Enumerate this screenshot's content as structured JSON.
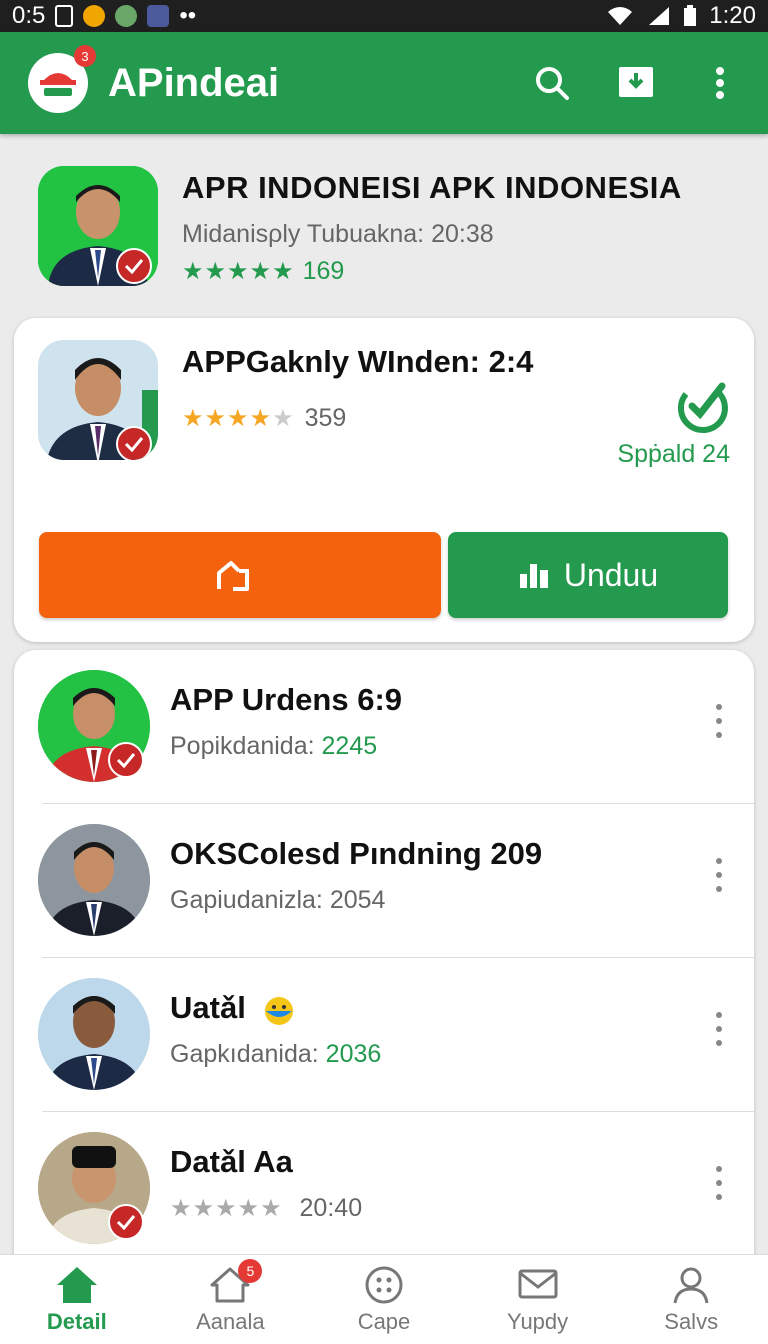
{
  "status_bar": {
    "left_text": "0:5",
    "time": "1:20"
  },
  "app_bar": {
    "title": "APindeai",
    "logo_badge": "3"
  },
  "header_app": {
    "title": "APR INDONEISI APK INDONESIA",
    "subtitle": "Midanisρly Tubuakna: 20:38",
    "stars": "★★★★★",
    "rating_count": "169"
  },
  "featured": {
    "title": "APPGaknly WInden: 2:4",
    "stars_filled": "★★★★",
    "stars_empty": "★",
    "rating_count": "359",
    "status_label": "Spṗald 24",
    "share_button_label": "",
    "download_button_label": "Unduu"
  },
  "list": [
    {
      "title": "APP Urdens 6:9",
      "sub_label": "Popikdanida: ",
      "sub_value": "2245",
      "value_green": true
    },
    {
      "title": "OKSColesd Pındning 209",
      "sub_label": "Gapiudanizla: ",
      "sub_value": "2054",
      "value_green": false
    },
    {
      "title": "Uatǎl",
      "sub_label": "Gapkıdanida: ",
      "sub_value": "2036",
      "value_green": true
    },
    {
      "title": "Datǎl Aa",
      "sub_label": "",
      "sub_value": "20:40",
      "value_green": false,
      "stars": "★★★★★"
    }
  ],
  "bottom_nav": [
    {
      "label": "Detail",
      "icon": "home-icon",
      "active": true
    },
    {
      "label": "Aanala",
      "icon": "house-outline-icon",
      "badge": "5"
    },
    {
      "label": "Cape",
      "icon": "grid-icon"
    },
    {
      "label": "Yupdy",
      "icon": "mail-icon"
    },
    {
      "label": "Salvs",
      "icon": "person-icon"
    }
  ],
  "colors": {
    "primary": "#239a4e",
    "accent": "#f4620e",
    "badge": "#e53935"
  }
}
